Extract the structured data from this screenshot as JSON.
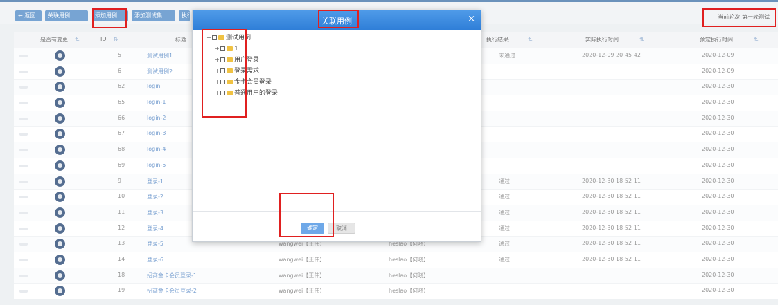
{
  "toolbar": {
    "buttons": [
      "← 返回",
      "关联用例",
      "添加用例",
      "添加测试集",
      "执行"
    ],
    "right_text": "当前轮次:第一轮测试"
  },
  "table": {
    "headers": [
      "是否有变更",
      "ID",
      "标题",
      "",
      "",
      "执行结果",
      "实际执行时间",
      "预定执行时间"
    ],
    "rows": [
      {
        "id": "5",
        "title": "测试用例1",
        "c1": "",
        "c2": "",
        "result": "未通过",
        "actual": "2020-12-09 20:45:42",
        "planned": "2020-12-09"
      },
      {
        "id": "6",
        "title": "测试用例2",
        "c1": "",
        "c2": "",
        "result": "",
        "actual": "",
        "planned": "2020-12-09"
      },
      {
        "id": "62",
        "title": "login",
        "c1": "",
        "c2": "",
        "result": "",
        "actual": "",
        "planned": "2020-12-30"
      },
      {
        "id": "65",
        "title": "login-1",
        "c1": "",
        "c2": "",
        "result": "",
        "actual": "",
        "planned": "2020-12-30"
      },
      {
        "id": "66",
        "title": "login-2",
        "c1": "",
        "c2": "",
        "result": "",
        "actual": "",
        "planned": "2020-12-30"
      },
      {
        "id": "67",
        "title": "login-3",
        "c1": "",
        "c2": "",
        "result": "",
        "actual": "",
        "planned": "2020-12-30"
      },
      {
        "id": "68",
        "title": "login-4",
        "c1": "",
        "c2": "",
        "result": "",
        "actual": "",
        "planned": "2020-12-30"
      },
      {
        "id": "69",
        "title": "login-5",
        "c1": "",
        "c2": "",
        "result": "",
        "actual": "",
        "planned": "2020-12-30"
      },
      {
        "id": "9",
        "title": "登录-1",
        "c1": "",
        "c2": "",
        "result": "通过",
        "actual": "2020-12-30 18:52:11",
        "planned": "2020-12-30"
      },
      {
        "id": "10",
        "title": "登录-2",
        "c1": "",
        "c2": "",
        "result": "通过",
        "actual": "2020-12-30 18:52:11",
        "planned": "2020-12-30"
      },
      {
        "id": "11",
        "title": "登录-3",
        "c1": "",
        "c2": "",
        "result": "通过",
        "actual": "2020-12-30 18:52:11",
        "planned": "2020-12-30"
      },
      {
        "id": "12",
        "title": "登录-4",
        "c1": "",
        "c2": "",
        "result": "通过",
        "actual": "2020-12-30 18:52:11",
        "planned": "2020-12-30"
      },
      {
        "id": "13",
        "title": "登录-5",
        "c1": "wangwei【王伟】",
        "c2": "heslao【何晓】",
        "result": "通过",
        "actual": "2020-12-30 18:52:11",
        "planned": "2020-12-30"
      },
      {
        "id": "14",
        "title": "登录-6",
        "c1": "wangwei【王伟】",
        "c2": "heslao【何晓】",
        "result": "通过",
        "actual": "2020-12-30 18:52:11",
        "planned": "2020-12-30"
      },
      {
        "id": "18",
        "title": "招商金卡会员登录-1",
        "c1": "wangwei【王伟】",
        "c2": "heslao【何晓】",
        "result": "",
        "actual": "",
        "planned": "2020-12-30"
      },
      {
        "id": "19",
        "title": "招商金卡会员登录-2",
        "c1": "wangwei【王伟】",
        "c2": "heslao【何晓】",
        "result": "",
        "actual": "",
        "planned": "2020-12-30"
      }
    ]
  },
  "modal": {
    "title": "关联用例",
    "close": "×",
    "tree_root": "测试用例",
    "tree_children": [
      "1",
      "用户登录",
      "登录需求",
      "金卡会员登录",
      "普通用户的登录"
    ],
    "ok_label": "确定",
    "cancel_label": "取消"
  }
}
